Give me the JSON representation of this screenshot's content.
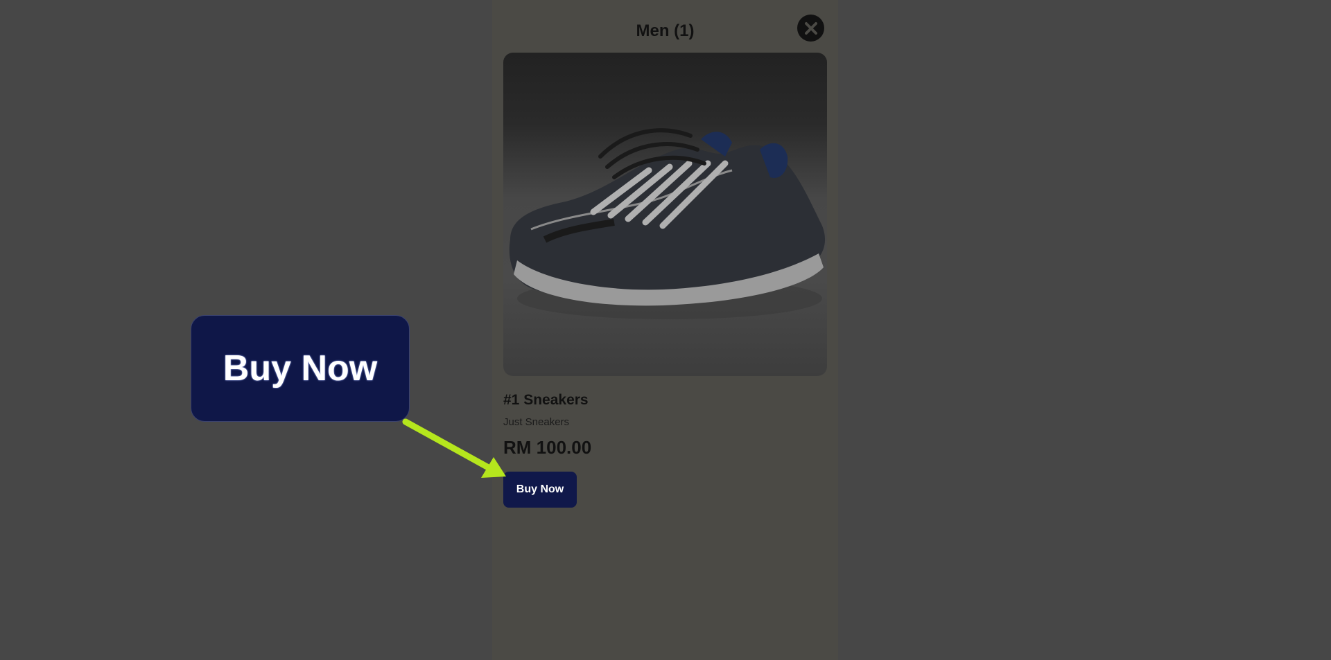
{
  "modal": {
    "title": "Men (1)",
    "close_icon": "close-icon"
  },
  "product": {
    "image_icon": "sneaker-image",
    "name": "#1 Sneakers",
    "description": "Just Sneakers",
    "price": "RM 100.00",
    "buy_label": "Buy Now"
  },
  "callout": {
    "label": "Buy Now",
    "arrow_color": "#b5e61d"
  },
  "colors": {
    "overlay": "#474747",
    "button": "#10184a"
  }
}
